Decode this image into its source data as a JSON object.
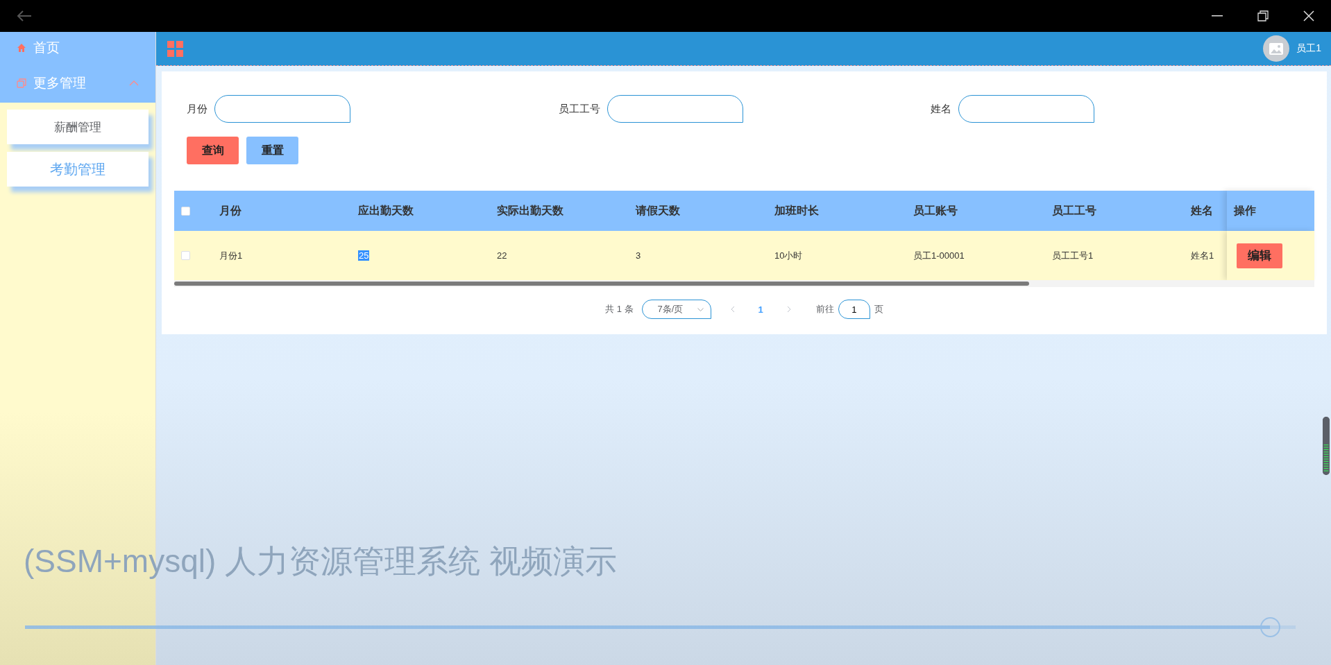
{
  "sidebar": {
    "items": [
      {
        "label": "首页",
        "kind": "link"
      },
      {
        "label": "更多管理",
        "kind": "group",
        "expanded": true,
        "children": [
          {
            "label": "薪酬管理",
            "selected": false
          },
          {
            "label": "考勤管理",
            "selected": true
          }
        ]
      }
    ]
  },
  "header": {
    "user": "员工1"
  },
  "search": {
    "fields": [
      {
        "label": "月份"
      },
      {
        "label": "员工工号"
      },
      {
        "label": "姓名"
      }
    ],
    "buttons": [
      {
        "label": "查询",
        "kind": "primary"
      },
      {
        "label": "重置",
        "kind": "secondary"
      }
    ]
  },
  "table": {
    "select_all": {
      "checked": false
    },
    "columns": [
      "月份",
      "应出勤天数",
      "实际出勤天数",
      "请假天数",
      "加班时长",
      "员工账号",
      "员工工号",
      "姓名",
      "操作"
    ],
    "rows": [
      {
        "checked": false,
        "cells": [
          {
            "text": "月份1",
            "highlighted": false
          },
          {
            "text": "25",
            "highlighted": true
          },
          {
            "text": "22",
            "highlighted": false
          },
          {
            "text": "3",
            "highlighted": false
          },
          {
            "text": "10小时",
            "highlighted": false
          },
          {
            "text": "员工1-00001",
            "highlighted": false
          },
          {
            "text": "员工工号1",
            "highlighted": false
          },
          {
            "text": "姓名1",
            "highlighted": false
          }
        ],
        "action": "编辑"
      }
    ]
  },
  "pagination": {
    "total": "共 1 条",
    "page_size": "7条/页",
    "pages": [
      {
        "label": "1",
        "selected": true
      }
    ],
    "goto_label": "前往",
    "goto_value": "1",
    "goto_suffix": "页"
  },
  "video": {
    "title": "(SSM+mysql) 人力资源管理系统 视频演示",
    "progress": {
      "level": 0.98
    }
  }
}
